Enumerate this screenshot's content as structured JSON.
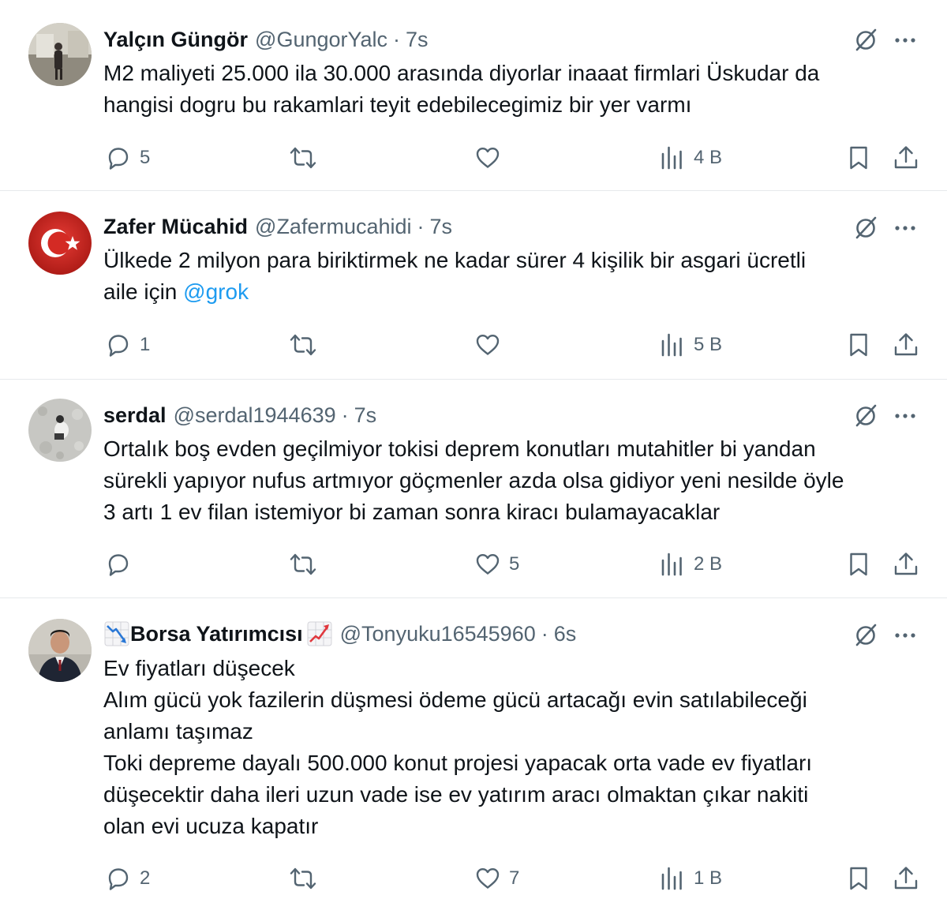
{
  "tweets": [
    {
      "name": "Yalçın Güngör",
      "handle": "@GungorYalc",
      "dot": "·",
      "time": "7s",
      "lines": [
        "M2 maliyeti 25.000 ila 30.000 arasında diyorlar inaaat firmlari Üskudar da",
        "hangisi dogru bu rakamlari teyit edebilecegimiz bir yer varmı"
      ],
      "replies": "5",
      "reposts": "",
      "likes": "",
      "views": "4 B"
    },
    {
      "name": "Zafer Mücahid",
      "handle": "@Zafermucahidi",
      "dot": "·",
      "time": "7s",
      "lines": [
        "Ülkede 2 milyon para biriktirmek ne kadar sürer 4 kişilik bir asgari ücretli",
        "aile için "
      ],
      "mention": "@grok",
      "replies": "1",
      "reposts": "",
      "likes": "",
      "views": "5 B"
    },
    {
      "name": "serdal",
      "handle": "@serdal1944639",
      "dot": "·",
      "time": "7s",
      "lines": [
        "Ortalık boş evden geçilmiyor tokisi deprem konutları mutahitler bi yandan",
        "sürekli yapıyor nufus artmıyor göçmenler azda olsa gidiyor yeni nesilde öyle",
        "3 artı 1 ev filan istemiyor bi zaman sonra kiracı bulamayacaklar"
      ],
      "replies": "",
      "reposts": "",
      "likes": "5",
      "views": "2 B"
    },
    {
      "name": "Borsa Yatırımcısı",
      "handle": "@Tonyuku16545960",
      "dot": "·",
      "time": "6s",
      "lines": [
        "Ev fiyatları düşecek",
        "Alım gücü yok fazilerin düşmesi ödeme gücü artacağı evin satılabileceği",
        "anlamı taşımaz",
        "Toki depreme dayalı 500.000  konut projesi yapacak orta vade ev fiyatları",
        "düşecektir daha ileri uzun vade ise ev yatırım aracı olmaktan çıkar nakiti",
        "olan evi ucuza kapatır"
      ],
      "replies": "2",
      "reposts": "",
      "likes": "7",
      "views": "1 B"
    }
  ],
  "icons": {
    "reply": "reply-icon",
    "repost": "repost-icon",
    "like": "heart-icon",
    "views": "views-chart-icon",
    "bookmark": "bookmark-icon",
    "share": "share-icon",
    "grok": "grok-icon",
    "more": "more-icon",
    "badge_left": "chart-decreasing-emoji",
    "badge_right": "chart-increasing-emoji"
  },
  "colors": {
    "text": "#0f1419",
    "secondary": "#536471",
    "link": "#1d9bf0",
    "divider": "#e6e9ec"
  }
}
